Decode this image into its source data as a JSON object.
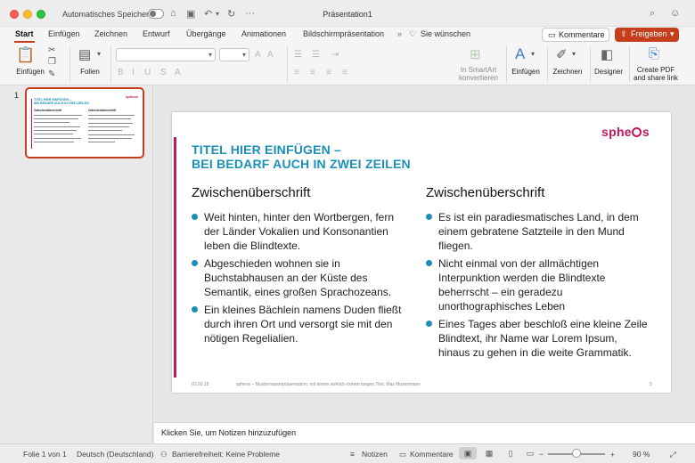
{
  "titlebar": {
    "autosave_label": "Automatisches Speichern",
    "document_title": "Präsentation1"
  },
  "tabs": [
    {
      "label": "Start",
      "active": true
    },
    {
      "label": "Einfügen"
    },
    {
      "label": "Zeichnen"
    },
    {
      "label": "Entwurf"
    },
    {
      "label": "Übergänge"
    },
    {
      "label": "Animationen"
    },
    {
      "label": "Bildschirmpräsentation"
    },
    {
      "label": "Sie wünschen"
    }
  ],
  "header_buttons": {
    "comments_label": "Kommentare",
    "share_label": "Freigeben"
  },
  "ribbon": {
    "paste_label": "Einfügen",
    "slides_label": "Folien",
    "smartart_label_1": "In SmartArt",
    "smartart_label_2": "konvertieren",
    "insert_label": "Einfügen",
    "draw_label": "Zeichnen",
    "designer_label": "Designer",
    "pdf_label_1": "Create PDF",
    "pdf_label_2": "and share link"
  },
  "thumbnails": [
    {
      "number": "1"
    }
  ],
  "slide": {
    "title_line1": "TITEL HIER EINFÜGEN –",
    "title_line2": "BEI BEDARF AUCH IN ZWEI ZEILEN",
    "logo": "sphe",
    "logo_after": "s",
    "left": {
      "heading": "Zwischenüberschrift",
      "bullets": [
        "Weit hinten, hinter den Wortbergen, fern der Länder Vokalien und Konsonantien leben die Blindtexte.",
        "Abgeschieden wohnen sie in Buchstabhausen an der Küste des Semantik, eines großen Sprachozeans.",
        "Ein kleines Bächlein namens Duden fließt durch ihren Ort und versorgt sie mit den nötigen Regelialien."
      ]
    },
    "right": {
      "heading": "Zwischenüberschrift",
      "bullets": [
        "Es ist ein paradiesmatisches Land, in dem einem gebratene Satzteile in den Mund fliegen.",
        "Nicht einmal von der allmächtigen Interpunktion werden die Blindtexte beherrscht – ein geradezu unorthographisches Leben",
        "Eines Tages aber beschloß eine kleine Zeile Blindtext, ihr Name war Lorem Ipsum, hinaus zu gehen in die weite Grammatik."
      ]
    },
    "footer_date": "01.02.18",
    "footer_text": "spheos – Mustermasterpräsentation, mit einem wirklich extrem langen Titel, Max Mustermann",
    "footer_page": "5"
  },
  "notes_placeholder": "Klicken Sie, um Notizen hinzuzufügen",
  "statusbar": {
    "slide_info": "Folie 1 von 1",
    "language": "Deutsch (Deutschland)",
    "accessibility": "Barrierefreiheit: Keine Probleme",
    "notes_label": "Notizen",
    "comments_label": "Kommentare",
    "zoom": "90 %",
    "zoom_fraction": 0.5
  },
  "colors": {
    "accent_orange": "#c43e1c",
    "slide_title_blue": "#1a90b8",
    "brand_magenta": "#c2185b"
  }
}
